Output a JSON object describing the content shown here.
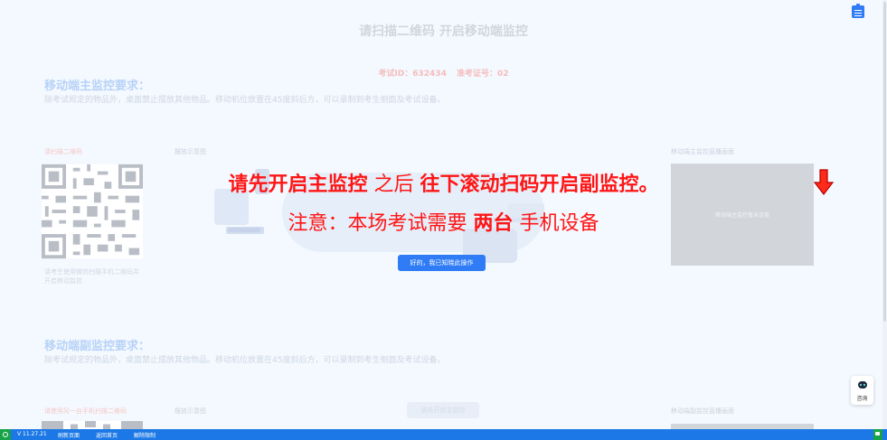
{
  "page": {
    "title": "请扫描二维码 开启移动端监控",
    "exam_id_label": "考试ID：632434",
    "seat_label": "准考证号：02"
  },
  "main_monitor": {
    "heading": "移动端主监控要求：",
    "description": "除考试规定的物品外，桌面禁止摆放其他物品。移动机位放置在45度斜后方，可以录制到考生侧面及考试设备。",
    "qr_label": "请扫描二维码",
    "qr_note": "请考生使用微信扫描手机二维码并开启移动监控",
    "example_label": "摆放示意图",
    "preview_label": "移动端主监控直播画面",
    "preview_text": "移动端主监控暂未连接"
  },
  "sub_monitor": {
    "heading": "移动端副监控要求：",
    "description": "除考试规定的物品外，桌面禁止摆放其他物品。移动机位放置在45度斜后方，可以录制到考生侧面及考试设备。",
    "qr_label": "请使用另一台手机扫描二维码",
    "example_label": "摆放示意图",
    "button_label": "请先开启主监控",
    "preview_label": "移动端副监控直播画面"
  },
  "overlay": {
    "line1_bold1": "请先开启主监控",
    "line1_mid": " 之后 ",
    "line1_bold2": "往下滚动扫码开启副监控。",
    "line2_a": "注意：本场考试需要 ",
    "line2_bold": "两台",
    "line2_b": " 手机设备",
    "button": "好的，我已知晓此操作"
  },
  "consult": {
    "label": "咨询"
  },
  "bottom_bar": {
    "version": "V 11.27.21",
    "refresh": "刷新页面",
    "home": "返回首页",
    "unlock": "解除限制"
  },
  "colors": {
    "accent": "#2f7cf6",
    "overlay_text": "#ff1515",
    "bottom_bar": "#1b78e6",
    "badge_green": "#17a346"
  }
}
